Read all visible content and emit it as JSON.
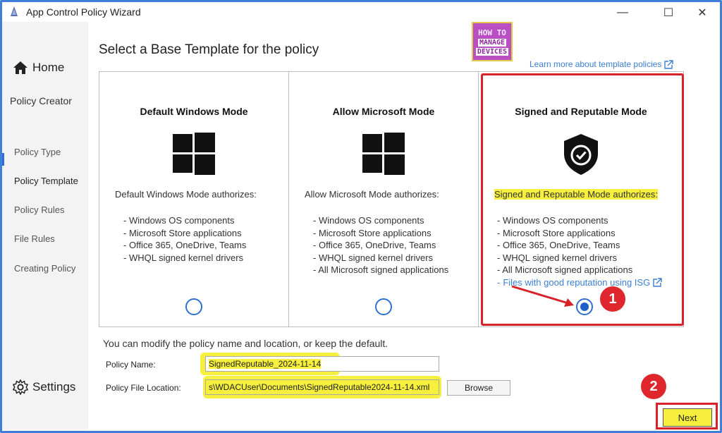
{
  "window": {
    "title": "App Control Policy Wizard",
    "minimize_glyph": "—",
    "maximize_glyph": "☐",
    "close_glyph": "✕"
  },
  "sidebar": {
    "home_label": "Home",
    "section_label": "Policy Creator",
    "items": [
      {
        "label": "Policy Type"
      },
      {
        "label": "Policy Template"
      },
      {
        "label": "Policy Rules"
      },
      {
        "label": "File Rules"
      },
      {
        "label": "Creating Policy"
      }
    ],
    "active_index": 1,
    "settings_label": "Settings"
  },
  "header": {
    "title": "Select a Base Template for the policy",
    "logo": {
      "line1": "HOW TO",
      "line2": "MANAGE",
      "line3": "DEVICES"
    },
    "learn_link": "Learn more about template policies"
  },
  "templates": [
    {
      "title": "Default Windows Mode",
      "icon": "windows-logo-icon",
      "description": "Default Windows Mode authorizes:",
      "items": [
        "Windows OS components",
        "Microsoft Store applications",
        "Office 365, OneDrive, Teams",
        "WHQL signed kernel drivers"
      ],
      "selected": false
    },
    {
      "title": "Allow Microsoft Mode",
      "icon": "windows-logo-icon",
      "description": "Allow Microsoft Mode authorizes:",
      "items": [
        "Windows OS components",
        "Microsoft Store applications",
        "Office 365, OneDrive, Teams",
        "WHQL signed kernel drivers",
        "All Microsoft signed applications"
      ],
      "selected": false
    },
    {
      "title": "Signed and Reputable Mode",
      "icon": "shield-check-icon",
      "description": "Signed and Reputable Mode authorizes:",
      "items": [
        "Windows OS components",
        "Microsoft Store applications",
        "Office 365, OneDrive, Teams",
        "WHQL signed kernel drivers",
        "All Microsoft signed applications"
      ],
      "link_item": "Files with good reputation using ISG",
      "selected": true
    }
  ],
  "annotations": {
    "badge1": "1",
    "badge2": "2"
  },
  "form": {
    "modify_text": "You can modify the policy name and location, or keep the default.",
    "name_label": "Policy Name:",
    "name_value": "SignedReputable_2024-11-14",
    "location_label": "Policy File Location:",
    "location_value": "s\\WDACUser\\Documents\\SignedReputable2024-11-14.xml",
    "browse_label": "Browse"
  },
  "footer": {
    "next_label": "Next"
  },
  "colors": {
    "accent": "#2f6fd2",
    "highlight": "#f6ef3d",
    "annotation_red": "#d8222a",
    "frame_blue": "#3f7fd9"
  }
}
